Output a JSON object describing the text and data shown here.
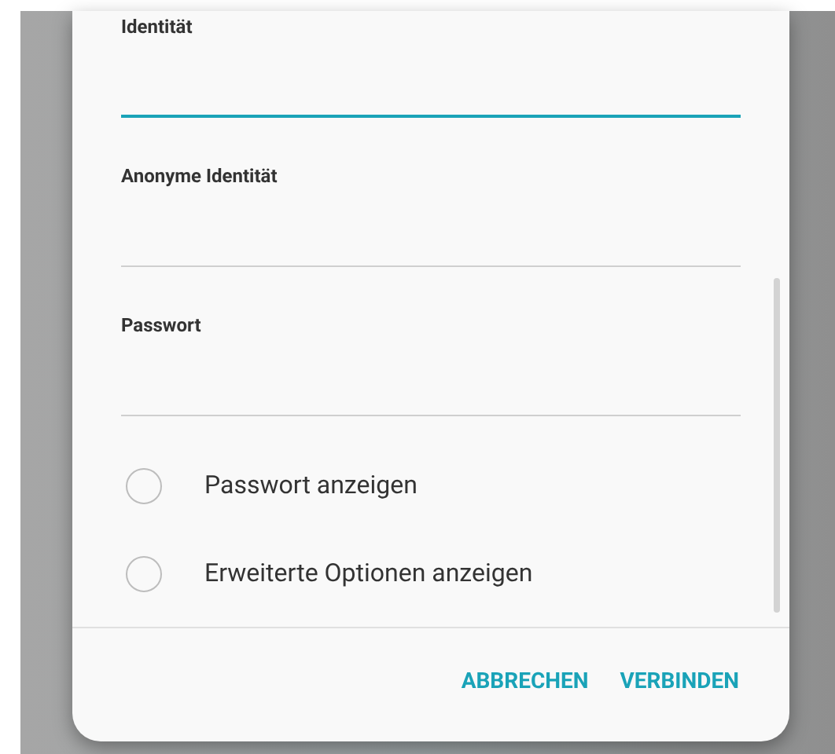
{
  "fields": [
    {
      "label": "Identität",
      "focused": true
    },
    {
      "label": "Anonyme Identität",
      "focused": false
    },
    {
      "label": "Passwort",
      "focused": false
    }
  ],
  "options": [
    {
      "label": "Passwort anzeigen",
      "checked": false
    },
    {
      "label": "Erweiterte Optionen anzeigen",
      "checked": false
    }
  ],
  "buttons": [
    "ABBRECHEN",
    "VERBINDEN"
  ]
}
